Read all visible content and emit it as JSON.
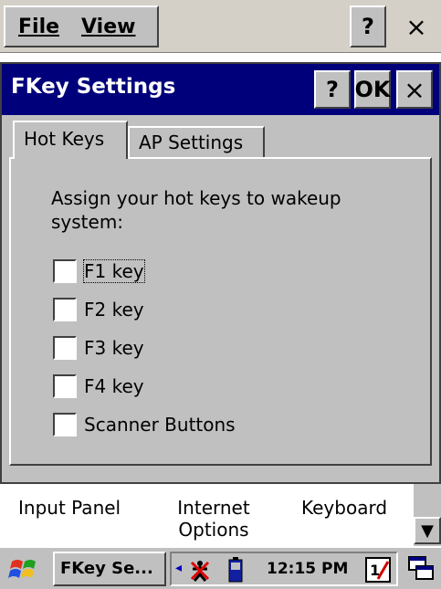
{
  "topbar": {
    "menu": [
      "File",
      "View"
    ],
    "help_label": "?",
    "close_label": "×"
  },
  "dialog": {
    "title": "FKey Settings",
    "help_label": "?",
    "ok_label": "OK",
    "close_label": "×",
    "tabs": [
      {
        "label": "Hot Keys",
        "selected": true
      },
      {
        "label": "AP Settings",
        "selected": false
      }
    ],
    "instruction": "Assign your hot keys to wakeup system:",
    "options": [
      {
        "label": "F1 key",
        "checked": false
      },
      {
        "label": "F2 key",
        "checked": false
      },
      {
        "label": "F3 key",
        "checked": false
      },
      {
        "label": "F4 key",
        "checked": false
      },
      {
        "label": "Scanner Buttons",
        "checked": false
      }
    ]
  },
  "control_panel": {
    "items": [
      "Input Panel",
      "Internet Options",
      "Keyboard"
    ]
  },
  "taskbar": {
    "task_label": "FKey Se...",
    "time": "12:15 PM"
  },
  "colors": {
    "titlebar": "#00007b",
    "face": "#c0c0c0"
  }
}
